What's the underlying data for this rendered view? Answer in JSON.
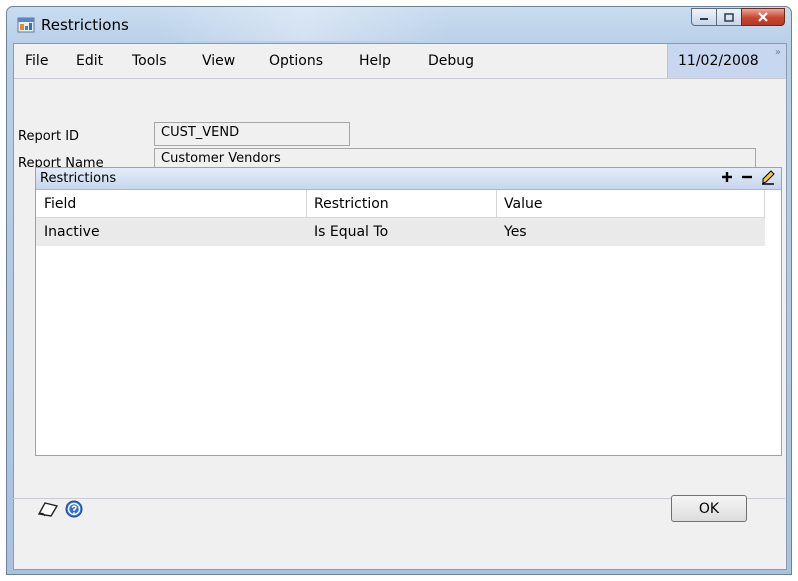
{
  "window": {
    "title": "Restrictions"
  },
  "menu": {
    "items": [
      "File",
      "Edit",
      "Tools",
      "View",
      "Options",
      "Help",
      "Debug"
    ]
  },
  "date": {
    "value": "11/02/2008"
  },
  "report": {
    "id_label": "Report ID",
    "id_value": "CUST_VEND",
    "name_label": "Report Name",
    "name_value": "Customer Vendors"
  },
  "restrictions_panel": {
    "title": "Restrictions",
    "columns": [
      "Field",
      "Restriction",
      "Value"
    ],
    "rows": [
      {
        "field": "Inactive",
        "restriction": "Is Equal To",
        "value": "Yes"
      }
    ]
  },
  "buttons": {
    "ok": "OK"
  },
  "icons": {
    "app": "app-window-icon",
    "add": "plus-icon",
    "remove": "minus-icon",
    "edit": "pencil-icon",
    "note": "note-icon",
    "help": "help-icon"
  },
  "colors": {
    "close_button": "#c9462f",
    "date_bg": "#c6d7ef",
    "title_bar": "#b8cfe8"
  }
}
